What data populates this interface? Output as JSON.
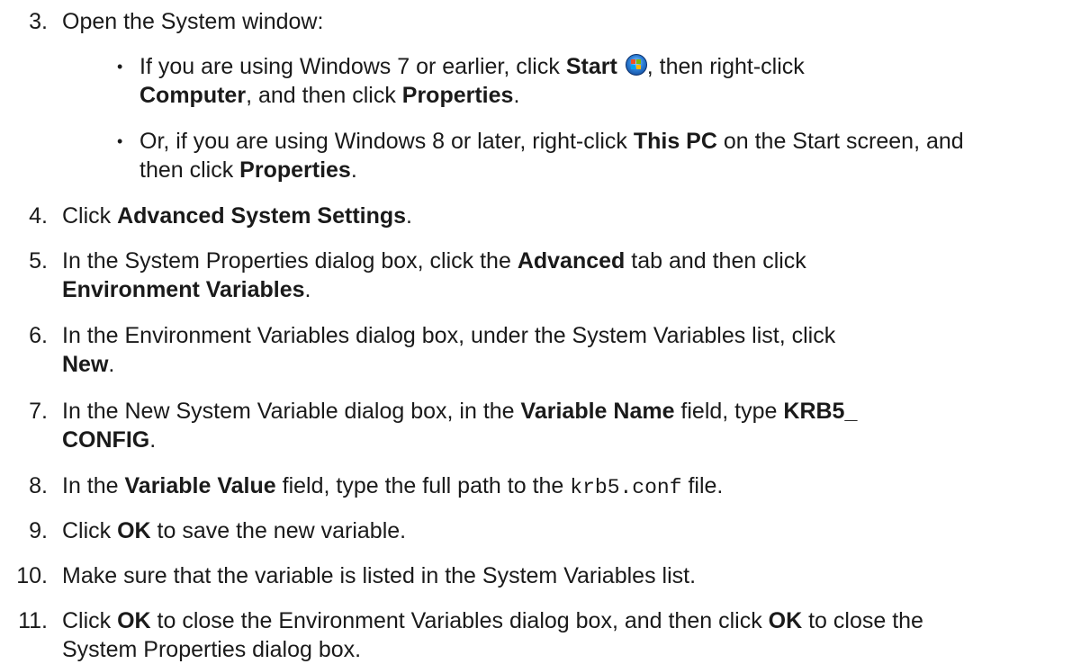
{
  "steps": {
    "s3": {
      "num": "3.",
      "text": "Open the System window:",
      "bullets": {
        "b1": {
          "p1": "If you are using Windows 7 or earlier, click ",
          "start": "Start",
          "p2": ", then right-click ",
          "computer": "Computer",
          "p3": ", and then click ",
          "properties": "Properties",
          "p4": "."
        },
        "b2": {
          "p1": "Or, if you are using Windows 8 or later, right-click ",
          "thispc": "This PC",
          "p2": " on the Start screen, and then click ",
          "properties": "Properties",
          "p3": "."
        }
      }
    },
    "s4": {
      "num": "4.",
      "p1": "Click ",
      "b1": "Advanced System Settings",
      "p2": "."
    },
    "s5": {
      "num": "5.",
      "p1": "In the System Properties dialog box, click the ",
      "b1": "Advanced",
      "p2": " tab and then click ",
      "b2": "Environment Variables",
      "p3": "."
    },
    "s6": {
      "num": "6.",
      "p1": "In the Environment Variables dialog box, under the System Variables list, click ",
      "b1": "New",
      "p2": "."
    },
    "s7": {
      "num": "7.",
      "p1": "In the New System Variable dialog box, in the ",
      "b1": "Variable Name",
      "p2": " field, type ",
      "b2a": "KRB5_",
      "b2b": "CONFIG",
      "p3": "."
    },
    "s8": {
      "num": "8.",
      "p1": "In the ",
      "b1": "Variable Value",
      "p2": " field, type the full path to the ",
      "code": "krb5.conf",
      "p3": " file."
    },
    "s9": {
      "num": "9.",
      "p1": "Click ",
      "b1": "OK",
      "p2": " to save the new variable."
    },
    "s10": {
      "num": "10.",
      "text": "Make sure that the variable is listed in the System Variables list."
    },
    "s11": {
      "num": "11.",
      "p1": "Click ",
      "b1": "OK",
      "p2": " to close the Environment Variables dialog box, and then click ",
      "b2": "OK",
      "p3": " to close the System Properties dialog box."
    }
  },
  "icons": {
    "start_orb": "windows-start-orb-icon"
  },
  "bullet_glyph": "•"
}
